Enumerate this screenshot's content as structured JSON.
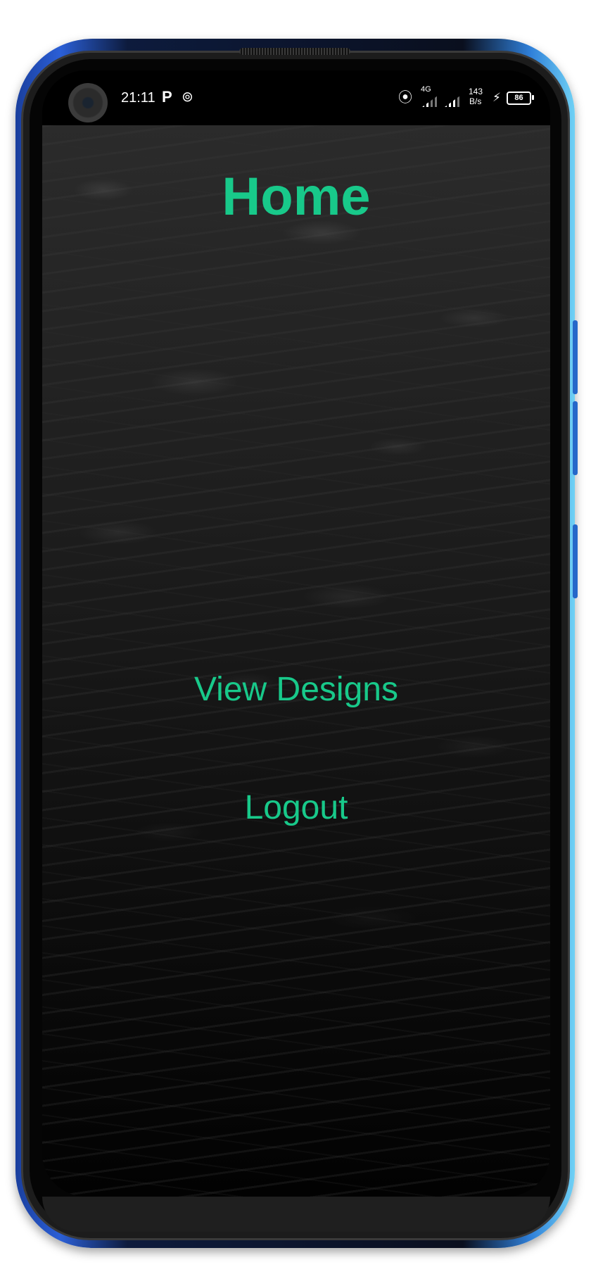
{
  "status_bar": {
    "time": "21:11",
    "app_icon_1": "P",
    "app_icon_2": "⊚",
    "hotspot_icon": "⦿",
    "network_type": "4G",
    "net_speed_value": "143",
    "net_speed_unit": "B/s",
    "charging_icon": "⚡",
    "battery_level": "86"
  },
  "page": {
    "title": "Home"
  },
  "menu": {
    "view_designs_label": "View Designs",
    "logout_label": "Logout"
  },
  "colors": {
    "accent": "#18c98a",
    "background": "#000000"
  }
}
